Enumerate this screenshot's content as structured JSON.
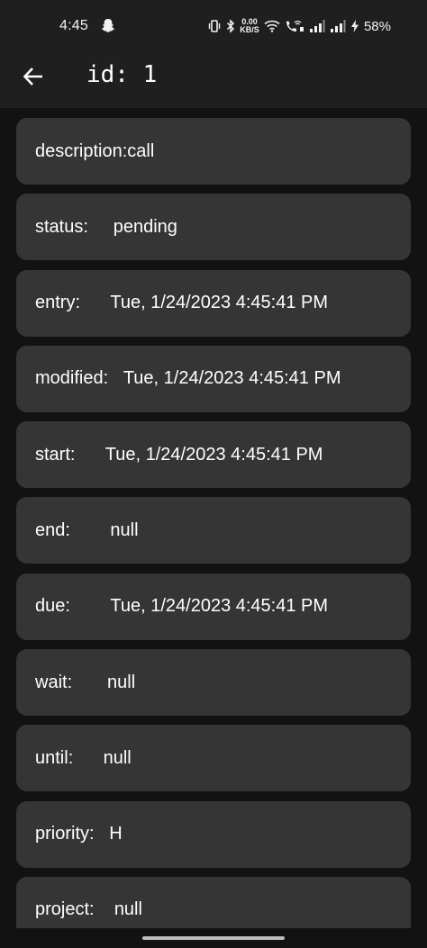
{
  "status_bar": {
    "time": "4:45",
    "snapchat_icon": "snapchat-ghost-icon",
    "net_speed_value": "0.00",
    "net_speed_unit": "KB/S",
    "battery": "58%",
    "icons": [
      "vibrate-icon",
      "bluetooth-icon",
      "wifi-icon",
      "wifi-calling-icon",
      "signal-icon",
      "signal-icon",
      "charging-icon"
    ]
  },
  "app_bar": {
    "back_icon": "arrow-back-icon",
    "title": "id: 1"
  },
  "fields": [
    {
      "label": "description:",
      "value": "call"
    },
    {
      "label": "status:     ",
      "value": "pending"
    },
    {
      "label": "entry:      ",
      "value": "Tue, 1/24/2023 4:45:41 PM"
    },
    {
      "label": "modified:   ",
      "value": "Tue, 1/24/2023 4:45:41 PM"
    },
    {
      "label": "start:      ",
      "value": "Tue, 1/24/2023 4:45:41 PM"
    },
    {
      "label": "end:        ",
      "value": "null"
    },
    {
      "label": "due:        ",
      "value": "Tue, 1/24/2023 4:45:41 PM"
    },
    {
      "label": "wait:       ",
      "value": "null"
    },
    {
      "label": "until:      ",
      "value": "null"
    },
    {
      "label": "priority:   ",
      "value": "H"
    },
    {
      "label": "project:    ",
      "value": "null"
    }
  ],
  "colors": {
    "background": "#121212",
    "bar": "#1f1f1f",
    "card": "#353535",
    "text": "#ffffff"
  }
}
